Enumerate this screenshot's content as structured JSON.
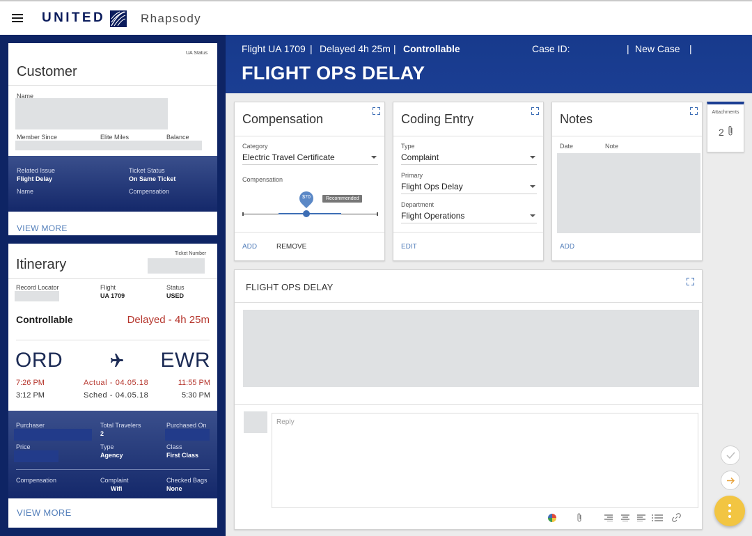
{
  "app": {
    "brand": "UNITED",
    "name": "Rhapsody"
  },
  "customer": {
    "title": "Customer",
    "ua_status_label": "UA Status",
    "name_label": "Name",
    "member_since_label": "Member Since",
    "elite_miles_label": "Elite Miles",
    "balance_label": "Balance",
    "related_issue_label": "Related Issue",
    "related_issue_value": "Flight Delay",
    "ticket_status_label": "Ticket Status",
    "ticket_status_value": "On Same Ticket",
    "name2_label": "Name",
    "compensation_label": "Compensation",
    "view_more": "VIEW MORE"
  },
  "itinerary": {
    "title": "Itinerary",
    "ticket_number_label": "Ticket Number",
    "record_locator_label": "Record Locator",
    "flight_label": "Flight",
    "flight_value": "UA 1709",
    "status_label": "Status",
    "status_value": "USED",
    "controllable": "Controllable",
    "delay": "Delayed - 4h 25m",
    "origin": "ORD",
    "destination": "EWR",
    "origin_actual": "7:26 PM",
    "actual_date": "Actual - 04.05.18",
    "dest_actual": "11:55 PM",
    "origin_sched": "3:12 PM",
    "sched_date": "Sched - 04.05.18",
    "dest_sched": "5:30 PM",
    "purchaser_label": "Purchaser",
    "total_travelers_label": "Total Travelers",
    "total_travelers_value": "2",
    "purchased_on_label": "Purchased On",
    "price_label": "Price",
    "type_label": "Type",
    "type_value": "Agency",
    "class_label": "Class",
    "class_value": "First Class",
    "compensation_label": "Compensation",
    "complaint_label": "Complaint",
    "complaint_value": "Wifi",
    "checked_bags_label": "Checked Bags",
    "checked_bags_value": "None",
    "view_more": "VIEW MORE"
  },
  "header": {
    "flight": "Flight UA 1709",
    "sep1": "|",
    "delayed": "Delayed 4h 25m",
    "sep2": "|",
    "controllable": "Controllable",
    "case_id_label": "Case ID:",
    "sep3": "|",
    "new_case": "New Case",
    "sep4": "|",
    "title": "FLIGHT OPS DELAY"
  },
  "compensation": {
    "title": "Compensation",
    "category_label": "Category",
    "category_value": "Electric Travel Certificate",
    "compensation_label": "Compensation",
    "slider_value": "$70",
    "slider_fraction": 0.47,
    "recommended": "Recommended",
    "add": "ADD",
    "remove": "REMOVE"
  },
  "coding": {
    "title": "Coding Entry",
    "type_label": "Type",
    "type_value": "Complaint",
    "primary_label": "Primary",
    "primary_value": "Flight Ops Delay",
    "department_label": "Department",
    "department_value": "Flight Operations",
    "edit": "EDIT"
  },
  "notes": {
    "title": "Notes",
    "date_label": "Date",
    "note_label": "Note",
    "add": "ADD"
  },
  "attachments": {
    "label": "Attachments",
    "count": "2"
  },
  "thread": {
    "title": "FLIGHT OPS DELAY",
    "reply_placeholder": "Reply"
  },
  "colors": {
    "navy": "#0e2464",
    "header_blue": "#1b3e93",
    "delay_red": "#b5352c",
    "link_blue": "#5580bb",
    "fab_yellow": "#f2c542"
  }
}
